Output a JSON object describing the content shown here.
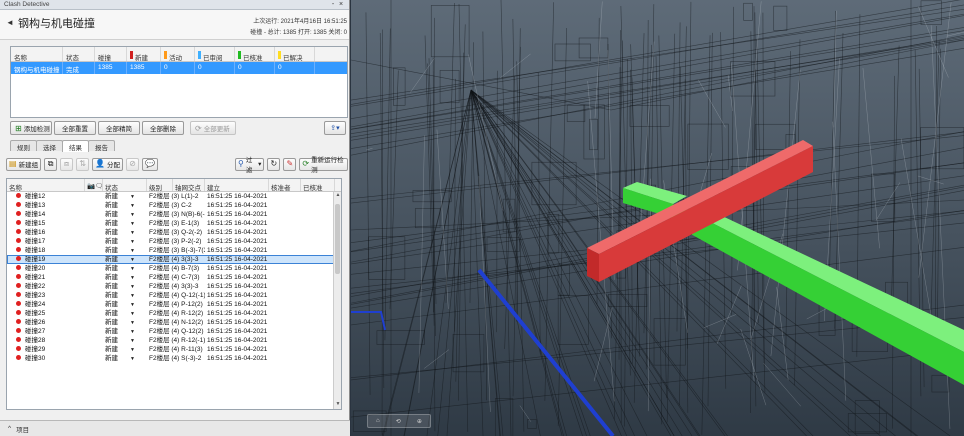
{
  "window": {
    "title": "Clash Detective",
    "controls": [
      "-",
      "×"
    ]
  },
  "header": {
    "collapse": "◄",
    "title": "钢构与机电碰撞",
    "last_run": "上次运行: 2021年4月16日 16:51:25",
    "stats": "碰撞 - 总计: 1385  打开: 1385  关闭: 0"
  },
  "tests_table": {
    "columns": [
      {
        "label": "名称",
        "w": 52,
        "color": ""
      },
      {
        "label": "状态",
        "w": 32,
        "color": ""
      },
      {
        "label": "碰撞",
        "w": 32,
        "color": ""
      },
      {
        "label": "新建",
        "w": 34,
        "color": "#d02020"
      },
      {
        "label": "活动",
        "w": 34,
        "color": "#ff9a1a"
      },
      {
        "label": "已审阅",
        "w": 40,
        "color": "#3fb0ff"
      },
      {
        "label": "已核准",
        "w": 40,
        "color": "#22bb22"
      },
      {
        "label": "已解决",
        "w": 40,
        "color": "#ffdd22"
      }
    ],
    "rows": [
      {
        "cells": [
          "钢构与机电碰撞",
          "完成",
          "1385",
          "1385",
          "0",
          "0",
          "0",
          "0"
        ]
      }
    ]
  },
  "toolbar1": {
    "add": "添加检测",
    "reset": "全部重置",
    "compact": "全部精简",
    "delete": "全部删除",
    "update": "全部更新",
    "export": "▾"
  },
  "tabs": [
    "规则",
    "选择",
    "结果",
    "报告"
  ],
  "active_tab": "结果",
  "toolbar2": {
    "new_group": "新建组",
    "assign": "分配",
    "filter": "过滤",
    "rerun": "重新运行检测"
  },
  "results": {
    "columns": [
      {
        "label": "名称",
        "w": 78
      },
      {
        "label": "",
        "w": 18
      },
      {
        "label": "状态",
        "w": 44
      },
      {
        "label": "级别",
        "w": 26
      },
      {
        "label": "轴网交点",
        "w": 32
      },
      {
        "label": "建立",
        "w": 64
      },
      {
        "label": "核准者",
        "w": 32
      },
      {
        "label": "已核准",
        "w": 34
      }
    ],
    "selected_index": 7,
    "rows": [
      {
        "name": "碰撞12",
        "status": "新建",
        "level": "F2楼层 (3)",
        "grid": "L(1)-2",
        "created": "16:51:25 16-04-2021"
      },
      {
        "name": "碰撞13",
        "status": "新建",
        "level": "F2楼层 (3)",
        "grid": "C-2",
        "created": "16:51:25 16-04-2021"
      },
      {
        "name": "碰撞14",
        "status": "新建",
        "level": "F2楼层 (3)",
        "grid": "N(B)-6(-2)",
        "created": "16:51:25 16-04-2021"
      },
      {
        "name": "碰撞15",
        "status": "新建",
        "level": "F2楼层 (3)",
        "grid": "E-1(3)",
        "created": "16:51:25 16-04-2021"
      },
      {
        "name": "碰撞16",
        "status": "新建",
        "level": "F2楼层 (3)",
        "grid": "Q-2(-2)",
        "created": "16:51:25 16-04-2021"
      },
      {
        "name": "碰撞17",
        "status": "新建",
        "level": "F2楼层 (3)",
        "grid": "P-2(-2)",
        "created": "16:51:25 16-04-2021"
      },
      {
        "name": "碰撞18",
        "status": "新建",
        "level": "F2楼层 (3)",
        "grid": "B(-3)-7(3)",
        "created": "16:51:25 16-04-2021"
      },
      {
        "name": "碰撞19",
        "status": "新建",
        "level": "F2楼层 (4)",
        "grid": "3(3)-3",
        "created": "16:51:25 16-04-2021"
      },
      {
        "name": "碰撞20",
        "status": "新建",
        "level": "F2楼层 (4)",
        "grid": "B-7(3)",
        "created": "16:51:25 16-04-2021"
      },
      {
        "name": "碰撞21",
        "status": "新建",
        "level": "F2楼层 (4)",
        "grid": "C-7(3)",
        "created": "16:51:25 16-04-2021"
      },
      {
        "name": "碰撞22",
        "status": "新建",
        "level": "F2楼层 (4)",
        "grid": "3(3)-3",
        "created": "16:51:25 16-04-2021"
      },
      {
        "name": "碰撞23",
        "status": "新建",
        "level": "F2楼层 (4)",
        "grid": "Q-12(-1)",
        "created": "16:51:25 16-04-2021"
      },
      {
        "name": "碰撞24",
        "status": "新建",
        "level": "F2楼层 (4)",
        "grid": "P-12(2)",
        "created": "16:51:25 16-04-2021"
      },
      {
        "name": "碰撞25",
        "status": "新建",
        "level": "F2楼层 (4)",
        "grid": "R-12(2)",
        "created": "16:51:25 16-04-2021"
      },
      {
        "name": "碰撞26",
        "status": "新建",
        "level": "F2楼层 (4)",
        "grid": "N-12(2)",
        "created": "16:51:25 16-04-2021"
      },
      {
        "name": "碰撞27",
        "status": "新建",
        "level": "F2楼层 (4)",
        "grid": "Q-12(2)",
        "created": "16:51:25 16-04-2021"
      },
      {
        "name": "碰撞28",
        "status": "新建",
        "level": "F2楼层 (4)",
        "grid": "R-12(-1)",
        "created": "16:51:25 16-04-2021"
      },
      {
        "name": "碰撞29",
        "status": "新建",
        "level": "F2楼层 (4)",
        "grid": "R-11(3)",
        "created": "16:51:25 16-04-2021"
      },
      {
        "name": "碰撞30",
        "status": "新建",
        "level": "F2楼层 (4)",
        "grid": "S(-3)-2",
        "created": "16:51:25 16-04-2021"
      }
    ]
  },
  "footer": {
    "toggle": "^",
    "label": "项目"
  },
  "colors": {
    "selection": "#3399ff",
    "clash_red": "#e02020",
    "beam_red": "#d83a3a",
    "duct_green": "#35d035",
    "pipe_blue": "#1f3fd0"
  }
}
